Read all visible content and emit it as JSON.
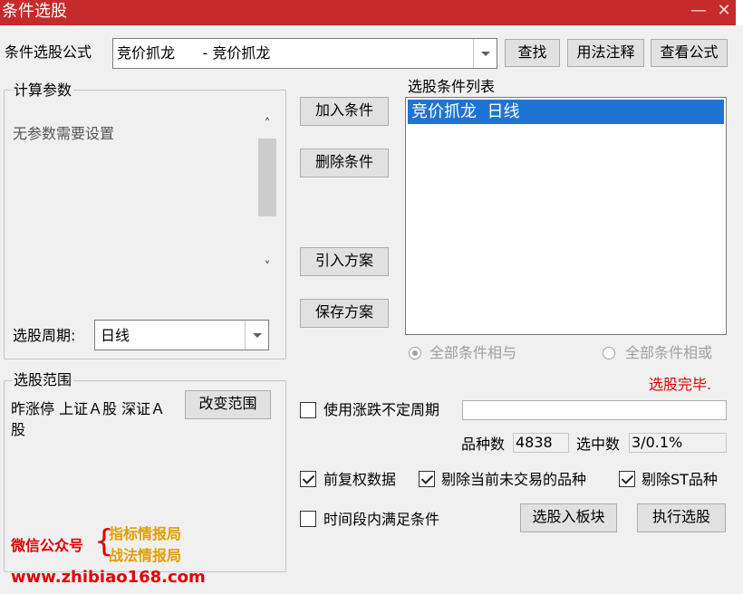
{
  "window": {
    "title": "条件选股",
    "minimize": "—",
    "close": "✕"
  },
  "formula": {
    "label": "条件选股公式",
    "value": "竞价抓龙      - 竞价抓龙",
    "find_button": "查找",
    "usage_button": "用法注释",
    "view_button": "查看公式"
  },
  "params": {
    "group_title": "计算参数",
    "message": "无参数需要设置",
    "scroll_up": "˄",
    "scroll_down": "˅",
    "period_label": "选股周期:",
    "period_value": "日线"
  },
  "actions": {
    "add": "加入条件",
    "delete": "删除条件",
    "import": "引入方案",
    "save": "保存方案"
  },
  "conditions": {
    "title": "选股条件列表",
    "items": [
      "竞价抓龙  日线"
    ],
    "radio_and": "全部条件相与",
    "radio_or": "全部条件相或"
  },
  "status": {
    "message": "选股完毕.",
    "color": "#e00000"
  },
  "scope": {
    "group_title": "选股范围",
    "text": "昨涨停 上证Ａ股 深证Ａ股",
    "change_button": "改变范围"
  },
  "options": {
    "variable_period_label": "使用涨跌不定周期",
    "variable_period_value": "",
    "count_label": "品种数",
    "count_value": "4838",
    "selected_label": "选中数",
    "selected_value": "3/0.1%",
    "adjust_label": "前复权数据",
    "exclude_untraded_label": "剔除当前未交易的品种",
    "exclude_st_label": "剔除ST品种",
    "time_range_label": "时间段内满足条件",
    "to_block_button": "选股入板块",
    "run_button": "执行选股"
  },
  "watermark": {
    "wechat_label": "微信公众号",
    "brace": "{",
    "line1": "指标情报局",
    "line2": "战法情报局",
    "url": "www.zhibiao168.com"
  }
}
